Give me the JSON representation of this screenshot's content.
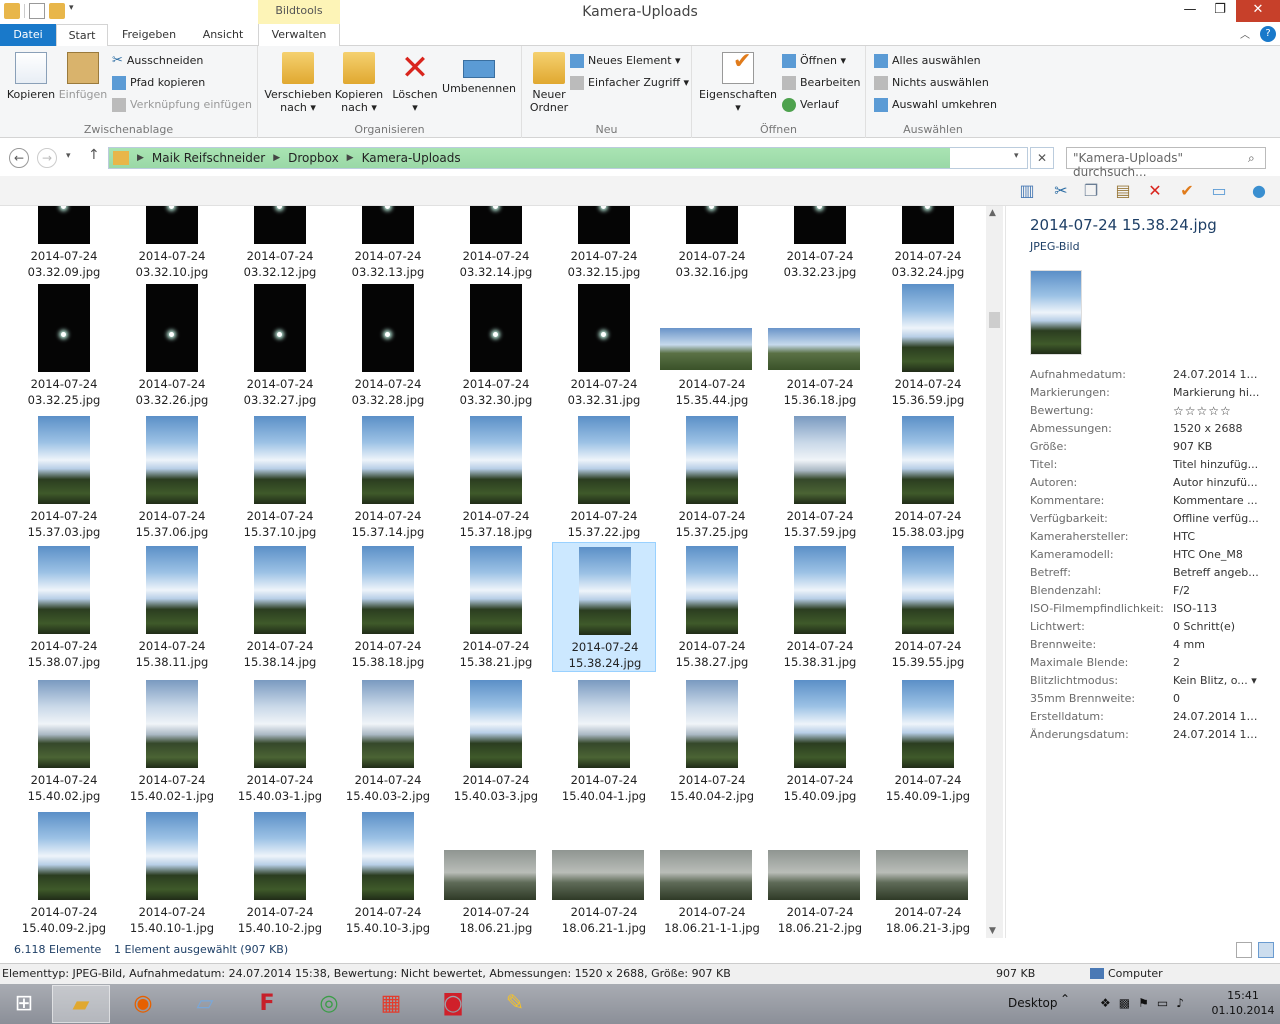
{
  "window": {
    "title": "Kamera-Uploads",
    "contextual_tab_group": "Bildtools",
    "min": "—",
    "max": "❐",
    "close": "✕"
  },
  "tabs": [
    "Datei",
    "Start",
    "Freigeben",
    "Ansicht",
    "Verwalten"
  ],
  "ribbon": {
    "clipboard": {
      "label": "Zwischenablage",
      "copy": "Kopieren",
      "paste": "Einfügen",
      "cut": "Ausschneiden",
      "copy_path": "Pfad kopieren",
      "paste_shortcut": "Verknüpfung einfügen"
    },
    "organize": {
      "label": "Organisieren",
      "move_to": [
        "Verschieben",
        "nach ▾"
      ],
      "copy_to": [
        "Kopieren",
        "nach ▾"
      ],
      "delete": [
        "Löschen",
        "▾"
      ],
      "rename": "Umbenennen"
    },
    "new": {
      "label": "Neu",
      "new_folder": [
        "Neuer",
        "Ordner"
      ],
      "new_item": "Neues Element ▾",
      "easy_access": "Einfacher Zugriff ▾"
    },
    "open": {
      "label": "Öffnen",
      "properties": [
        "Eigenschaften",
        "▾"
      ],
      "open": "Öffnen ▾",
      "edit": "Bearbeiten",
      "history": "Verlauf"
    },
    "select": {
      "label": "Auswählen",
      "select_all": "Alles auswählen",
      "select_none": "Nichts auswählen",
      "invert": "Auswahl umkehren"
    }
  },
  "address": {
    "crumbs": [
      "Maik Reifschneider",
      "Dropbox",
      "Kamera-Uploads"
    ],
    "search_placeholder": "\"Kamera-Uploads\" durchsuch..."
  },
  "files": [
    {
      "l1": "2014-07-24",
      "l2": "03.32.09.jpg",
      "kind": "night"
    },
    {
      "l1": "2014-07-24",
      "l2": "03.32.10.jpg",
      "kind": "night"
    },
    {
      "l1": "2014-07-24",
      "l2": "03.32.12.jpg",
      "kind": "night"
    },
    {
      "l1": "2014-07-24",
      "l2": "03.32.13.jpg",
      "kind": "night"
    },
    {
      "l1": "2014-07-24",
      "l2": "03.32.14.jpg",
      "kind": "night"
    },
    {
      "l1": "2014-07-24",
      "l2": "03.32.15.jpg",
      "kind": "night"
    },
    {
      "l1": "2014-07-24",
      "l2": "03.32.16.jpg",
      "kind": "night"
    },
    {
      "l1": "2014-07-24",
      "l2": "03.32.23.jpg",
      "kind": "night"
    },
    {
      "l1": "2014-07-24",
      "l2": "03.32.24.jpg",
      "kind": "night"
    },
    {
      "l1": "2014-07-24",
      "l2": "03.32.25.jpg",
      "kind": "night"
    },
    {
      "l1": "2014-07-24",
      "l2": "03.32.26.jpg",
      "kind": "night"
    },
    {
      "l1": "2014-07-24",
      "l2": "03.32.27.jpg",
      "kind": "night"
    },
    {
      "l1": "2014-07-24",
      "l2": "03.32.28.jpg",
      "kind": "night"
    },
    {
      "l1": "2014-07-24",
      "l2": "03.32.30.jpg",
      "kind": "night"
    },
    {
      "l1": "2014-07-24",
      "l2": "03.32.31.jpg",
      "kind": "night"
    },
    {
      "l1": "2014-07-24",
      "l2": "15.35.44.jpg",
      "kind": "wide"
    },
    {
      "l1": "2014-07-24",
      "l2": "15.36.18.jpg",
      "kind": "wide"
    },
    {
      "l1": "2014-07-24",
      "l2": "15.36.59.jpg",
      "kind": "sky"
    },
    {
      "l1": "2014-07-24",
      "l2": "15.37.03.jpg",
      "kind": "sky"
    },
    {
      "l1": "2014-07-24",
      "l2": "15.37.06.jpg",
      "kind": "sky"
    },
    {
      "l1": "2014-07-24",
      "l2": "15.37.10.jpg",
      "kind": "sky"
    },
    {
      "l1": "2014-07-24",
      "l2": "15.37.14.jpg",
      "kind": "sky"
    },
    {
      "l1": "2014-07-24",
      "l2": "15.37.18.jpg",
      "kind": "sky"
    },
    {
      "l1": "2014-07-24",
      "l2": "15.37.22.jpg",
      "kind": "sky"
    },
    {
      "l1": "2014-07-24",
      "l2": "15.37.25.jpg",
      "kind": "sky"
    },
    {
      "l1": "2014-07-24",
      "l2": "15.37.59.jpg",
      "kind": "sky2"
    },
    {
      "l1": "2014-07-24",
      "l2": "15.38.03.jpg",
      "kind": "sky"
    },
    {
      "l1": "2014-07-24",
      "l2": "15.38.07.jpg",
      "kind": "sky"
    },
    {
      "l1": "2014-07-24",
      "l2": "15.38.11.jpg",
      "kind": "sky"
    },
    {
      "l1": "2014-07-24",
      "l2": "15.38.14.jpg",
      "kind": "sky"
    },
    {
      "l1": "2014-07-24",
      "l2": "15.38.18.jpg",
      "kind": "sky"
    },
    {
      "l1": "2014-07-24",
      "l2": "15.38.21.jpg",
      "kind": "sky"
    },
    {
      "l1": "2014-07-24",
      "l2": "15.38.24.jpg",
      "kind": "sky",
      "selected": true
    },
    {
      "l1": "2014-07-24",
      "l2": "15.38.27.jpg",
      "kind": "sky"
    },
    {
      "l1": "2014-07-24",
      "l2": "15.38.31.jpg",
      "kind": "sky"
    },
    {
      "l1": "2014-07-24",
      "l2": "15.39.55.jpg",
      "kind": "sky"
    },
    {
      "l1": "2014-07-24",
      "l2": "15.40.02.jpg",
      "kind": "sky2"
    },
    {
      "l1": "2014-07-24",
      "l2": "15.40.02-1.jpg",
      "kind": "sky2"
    },
    {
      "l1": "2014-07-24",
      "l2": "15.40.03-1.jpg",
      "kind": "sky2"
    },
    {
      "l1": "2014-07-24",
      "l2": "15.40.03-2.jpg",
      "kind": "sky2"
    },
    {
      "l1": "2014-07-24",
      "l2": "15.40.03-3.jpg",
      "kind": "sky"
    },
    {
      "l1": "2014-07-24",
      "l2": "15.40.04-1.jpg",
      "kind": "sky2"
    },
    {
      "l1": "2014-07-24",
      "l2": "15.40.04-2.jpg",
      "kind": "sky2"
    },
    {
      "l1": "2014-07-24",
      "l2": "15.40.09.jpg",
      "kind": "sky"
    },
    {
      "l1": "2014-07-24",
      "l2": "15.40.09-1.jpg",
      "kind": "sky"
    },
    {
      "l1": "2014-07-24",
      "l2": "15.40.09-2.jpg",
      "kind": "sky"
    },
    {
      "l1": "2014-07-24",
      "l2": "15.40.10-1.jpg",
      "kind": "sky"
    },
    {
      "l1": "2014-07-24",
      "l2": "15.40.10-2.jpg",
      "kind": "sky"
    },
    {
      "l1": "2014-07-24",
      "l2": "15.40.10-3.jpg",
      "kind": "sky"
    },
    {
      "l1": "2014-07-24",
      "l2": "18.06.21.jpg",
      "kind": "grey"
    },
    {
      "l1": "2014-07-24",
      "l2": "18.06.21-1.jpg",
      "kind": "grey"
    },
    {
      "l1": "2014-07-24",
      "l2": "18.06.21-1-1.jpg",
      "kind": "grey"
    },
    {
      "l1": "2014-07-24",
      "l2": "18.06.21-2.jpg",
      "kind": "grey"
    },
    {
      "l1": "2014-07-24",
      "l2": "18.06.21-3.jpg",
      "kind": "grey"
    }
  ],
  "details": {
    "title": "2014-07-24 15.38.24.jpg",
    "type": "JPEG-Bild",
    "rating_stars": "☆☆☆☆☆",
    "props": [
      {
        "k": "Aufnahmedatum:",
        "v": "24.07.2014 15:..."
      },
      {
        "k": "Markierungen:",
        "v": "Markierung hi..."
      },
      {
        "k": "Bewertung:",
        "v": "",
        "stars": true
      },
      {
        "k": "Abmessungen:",
        "v": "1520 x 2688"
      },
      {
        "k": "Größe:",
        "v": "907 KB"
      },
      {
        "k": "Titel:",
        "v": "Titel hinzufüg..."
      },
      {
        "k": "Autoren:",
        "v": "Autor hinzufü..."
      },
      {
        "k": "Kommentare:",
        "v": "Kommentare ..."
      },
      {
        "k": "Verfügbarkeit:",
        "v": "Offline verfüg..."
      },
      {
        "k": "Kamerahersteller:",
        "v": "HTC"
      },
      {
        "k": "Kameramodell:",
        "v": "HTC One_M8"
      },
      {
        "k": "Betreff:",
        "v": "Betreff angeb..."
      },
      {
        "k": "Blendenzahl:",
        "v": "F/2"
      },
      {
        "k": "ISO-Filmempfindlichkeit:",
        "v": "ISO-113"
      },
      {
        "k": "Lichtwert:",
        "v": "0 Schritt(e)"
      },
      {
        "k": "Brennweite:",
        "v": "4 mm"
      },
      {
        "k": "Maximale Blende:",
        "v": "2"
      },
      {
        "k": "Blitzlichtmodus:",
        "v": "Kein Blitz, o... ▾"
      },
      {
        "k": "35mm Brennweite:",
        "v": "0"
      },
      {
        "k": "Erstelldatum:",
        "v": "24.07.2014 18:..."
      },
      {
        "k": "Änderungsdatum:",
        "v": "24.07.2014 15:..."
      }
    ]
  },
  "status": {
    "count": "6.118 Elemente",
    "selected": "1 Element ausgewählt (907 KB)"
  },
  "infobar": {
    "text": "Elementtyp: JPEG-Bild, Aufnahmedatum: 24.07.2014 15:38, Bewertung: Nicht bewertet, Abmessungen: 1520 x 2688, Größe: 907 KB",
    "size": "907 KB",
    "location": "Computer"
  },
  "taskbar": {
    "desktop": "Desktop",
    "time": "15:41",
    "date": "01.10.2014"
  },
  "colors": {
    "accent": "#1979ca",
    "selection": "#cce8ff",
    "address_bg": "#a9e4b3",
    "close_btn": "#c7402a"
  }
}
